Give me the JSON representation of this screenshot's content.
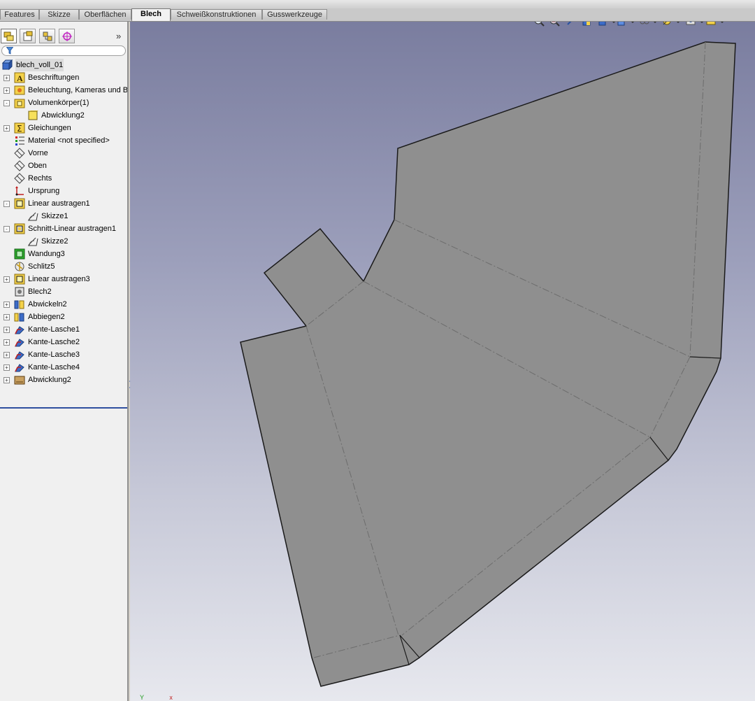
{
  "command_tabs": [
    "Features",
    "Skizze",
    "Oberflächen",
    "Blech",
    "Schweißkonstruktionen",
    "Gusswerkzeuge"
  ],
  "active_tab": "Blech",
  "panel": {
    "expand_glyph": "»",
    "filter_placeholder": "",
    "tabs": [
      "feature-manager-tab",
      "property-manager-tab",
      "configuration-manager-tab",
      "dimxpert-tab"
    ]
  },
  "tree": [
    {
      "label": "blech_voll_01",
      "icon": "part-icon",
      "expander": "",
      "indent": 0
    },
    {
      "label": "Beschriftungen",
      "icon": "annotations-icon",
      "expander": "+",
      "indent": 1
    },
    {
      "label": "Beleuchtung, Kameras und Bü",
      "icon": "lights-icon",
      "expander": "+",
      "indent": 1
    },
    {
      "label": "Volumenkörper(1)",
      "icon": "solid-bodies-folder-icon",
      "expander": "-",
      "indent": 1
    },
    {
      "label": "Abwicklung2",
      "icon": "body-icon",
      "expander": "",
      "indent": 2
    },
    {
      "label": "Gleichungen",
      "icon": "equations-icon",
      "expander": "+",
      "indent": 1
    },
    {
      "label": "Material <not specified>",
      "icon": "material-icon",
      "expander": "",
      "indent": 1
    },
    {
      "label": "Vorne",
      "icon": "plane-icon",
      "expander": "",
      "indent": 1
    },
    {
      "label": "Oben",
      "icon": "plane-icon",
      "expander": "",
      "indent": 1
    },
    {
      "label": "Rechts",
      "icon": "plane-icon",
      "expander": "",
      "indent": 1
    },
    {
      "label": "Ursprung",
      "icon": "origin-icon",
      "expander": "",
      "indent": 1
    },
    {
      "label": "Linear austragen1",
      "icon": "extrude-icon",
      "expander": "-",
      "indent": 1
    },
    {
      "label": "Skizze1",
      "icon": "sketch-icon",
      "expander": "",
      "indent": 2
    },
    {
      "label": "Schnitt-Linear austragen1",
      "icon": "cut-extrude-icon",
      "expander": "-",
      "indent": 1
    },
    {
      "label": "Skizze2",
      "icon": "sketch-icon",
      "expander": "",
      "indent": 2
    },
    {
      "label": "Wandung3",
      "icon": "shell-icon",
      "expander": "",
      "indent": 1
    },
    {
      "label": "Schlitz5",
      "icon": "rip-icon",
      "expander": "",
      "indent": 1
    },
    {
      "label": "Linear austragen3",
      "icon": "extrude-icon",
      "expander": "+",
      "indent": 1
    },
    {
      "label": "Blech2",
      "icon": "sheet-metal-icon",
      "expander": "",
      "indent": 1
    },
    {
      "label": "Abwickeln2",
      "icon": "unfold-icon",
      "expander": "+",
      "indent": 1
    },
    {
      "label": "Abbiegen2",
      "icon": "fold-icon",
      "expander": "+",
      "indent": 1
    },
    {
      "label": "Kante-Lasche1",
      "icon": "edge-flange-icon",
      "expander": "+",
      "indent": 1
    },
    {
      "label": "Kante-Lasche2",
      "icon": "edge-flange-icon",
      "expander": "+",
      "indent": 1
    },
    {
      "label": "Kante-Lasche3",
      "icon": "edge-flange-icon",
      "expander": "+",
      "indent": 1
    },
    {
      "label": "Kante-Lasche4",
      "icon": "edge-flange-icon",
      "expander": "+",
      "indent": 1
    },
    {
      "label": "Abwicklung2",
      "icon": "flat-pattern-icon",
      "expander": "+",
      "indent": 1
    }
  ],
  "heads_up_toolbar": [
    "zoom-to-fit-icon",
    "zoom-to-area-icon",
    "previous-view-icon",
    "section-view-icon",
    "view-orientation-icon",
    "display-style-icon",
    "hide-show-items-icon",
    "edit-appearance-icon",
    "apply-scene-icon",
    "view-settings-icon"
  ],
  "colors": {
    "sheet_fill": "#8f8f8f",
    "bend_line": "#6c6c6c",
    "viewport_top": "#7a7d9f",
    "viewport_bottom": "#e7e8ee",
    "tree_end_marker": "#2f4f9f"
  }
}
